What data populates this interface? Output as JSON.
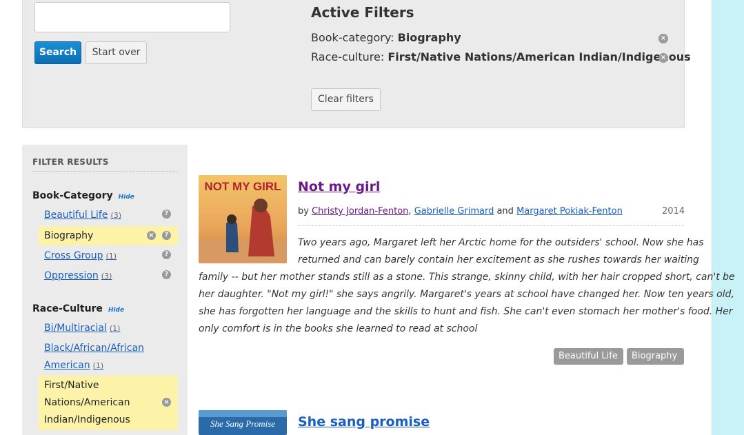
{
  "search": {
    "placeholder": "",
    "value": "",
    "search_label": "Search",
    "start_over_label": "Start over"
  },
  "active_filters": {
    "title": "Active Filters",
    "filters": [
      {
        "label": "Book-category:",
        "value": "Biography"
      },
      {
        "label": "Race-culture:",
        "value": "First/Native Nations/American Indian/Indigenous"
      }
    ],
    "clear_label": "Clear filters"
  },
  "sidebar": {
    "title": "FILTER RESULTS",
    "facets": [
      {
        "name": "Book-Category",
        "hide_label": "Hide",
        "items": [
          {
            "label": "Beautiful Life",
            "count": "(3)",
            "selected": false
          },
          {
            "label": "Biography",
            "count": "",
            "selected": true
          },
          {
            "label": "Cross Group",
            "count": "(1)",
            "selected": false
          },
          {
            "label": "Oppression",
            "count": "(3)",
            "selected": false
          }
        ]
      },
      {
        "name": "Race-Culture",
        "hide_label": "Hide",
        "items": [
          {
            "label": "Bi/Multiracial",
            "count": "(1)",
            "selected": false
          },
          {
            "label_line1": "Black/African/African",
            "label_line2": "American",
            "count": "(1)",
            "selected": false
          },
          {
            "label_line1": "First/Native",
            "label_line2": "Nations/American",
            "label_line3": "Indian/Indigenous",
            "selected": true
          }
        ]
      }
    ]
  },
  "results": [
    {
      "title": "Not my girl",
      "cover_text": "NOT MY GIRL",
      "by": "by",
      "and": "and",
      "authors": [
        "Christy Jordan-Fenton",
        "Gabrielle Grimard",
        "Margaret Pokiak-Fenton"
      ],
      "year": "2014",
      "description_lines": [
        "Two years ago, Margaret left her Arctic home for the outsiders' school. Now she has",
        "returned and can barely contain her excitement as she rushes towards her waiting",
        "family -- but her mother stands still as a stone. This strange, skinny child, with her hair cropped short, can't be",
        "her daughter. \"Not my girl!\" she says angrily. Margaret's years at school have changed her. Now ten years old,",
        "she has forgotten her language and the skills to hunt and fish. She can't even stomach her mother's food. Her",
        "only comfort is in the books she learned to read at school"
      ],
      "tags": [
        "Beautiful Life",
        "Biography"
      ]
    },
    {
      "title": "She sang promise",
      "cover_text": "She Sang Promise"
    }
  ],
  "colors": {
    "accent": "#1a5fbf",
    "visited": "#6a1a8a",
    "highlight": "#fcf3a8",
    "right_strip": "#c8f2f8"
  }
}
